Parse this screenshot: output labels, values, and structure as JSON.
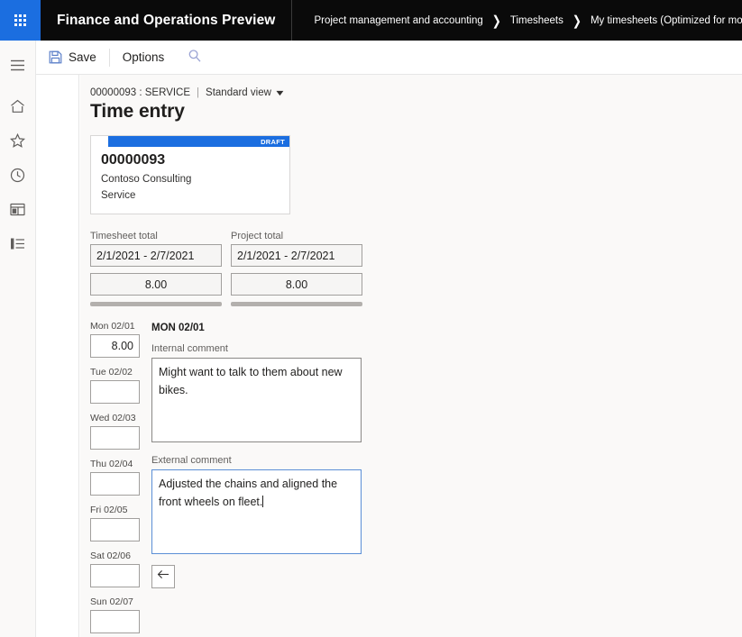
{
  "header": {
    "waffle_icon": "app-launcher-icon",
    "app_title": "Finance and Operations Preview",
    "breadcrumb": [
      {
        "label": "Project management and accounting"
      },
      {
        "label": "Timesheets"
      },
      {
        "label": "My timesheets (Optimized for mobile)"
      }
    ],
    "separator": "❯"
  },
  "command_bar": {
    "save_label": "Save",
    "save_icon": "save-floppy-icon",
    "options_label": "Options",
    "search_icon": "search-icon"
  },
  "left_rail": {
    "items": [
      {
        "icon": "hamburger-menu-icon",
        "name": "navigation-menu"
      },
      {
        "icon": "home-icon",
        "name": "home"
      },
      {
        "icon": "star-icon",
        "name": "favorites"
      },
      {
        "icon": "clock-icon",
        "name": "recent"
      },
      {
        "icon": "workspace-icon",
        "name": "workspaces"
      },
      {
        "icon": "list-icon",
        "name": "modules"
      }
    ]
  },
  "page": {
    "record_caption": "00000093 : SERVICE",
    "pipe": "|",
    "view_name": "Standard view",
    "chevron": "⌄",
    "title": "Time entry"
  },
  "draft_card": {
    "status_badge": "DRAFT",
    "number": "00000093",
    "customer": "Contoso Consulting",
    "category": "Service",
    "accent_color": "#1b6ee0"
  },
  "totals": [
    {
      "label": "Timesheet total",
      "period": "2/1/2021 - 2/7/2021",
      "amount": "8.00"
    },
    {
      "label": "Project total",
      "period": "2/1/2021 - 2/7/2021",
      "amount": "8.00"
    }
  ],
  "days": [
    {
      "label": "Mon 02/01",
      "value": "8.00"
    },
    {
      "label": "Tue 02/02",
      "value": ""
    },
    {
      "label": "Wed 02/03",
      "value": ""
    },
    {
      "label": "Thu 02/04",
      "value": ""
    },
    {
      "label": "Fri 02/05",
      "value": ""
    },
    {
      "label": "Sat 02/06",
      "value": ""
    },
    {
      "label": "Sun 02/07",
      "value": ""
    }
  ],
  "detail": {
    "selected_day": "MON 02/01",
    "internal_label": "Internal comment",
    "internal_value": "Might want to talk to them about new bikes.",
    "external_label": "External comment",
    "external_value": "Adjusted the chains and aligned the front wheels on fleet.",
    "back_icon": "arrow-left-icon"
  }
}
